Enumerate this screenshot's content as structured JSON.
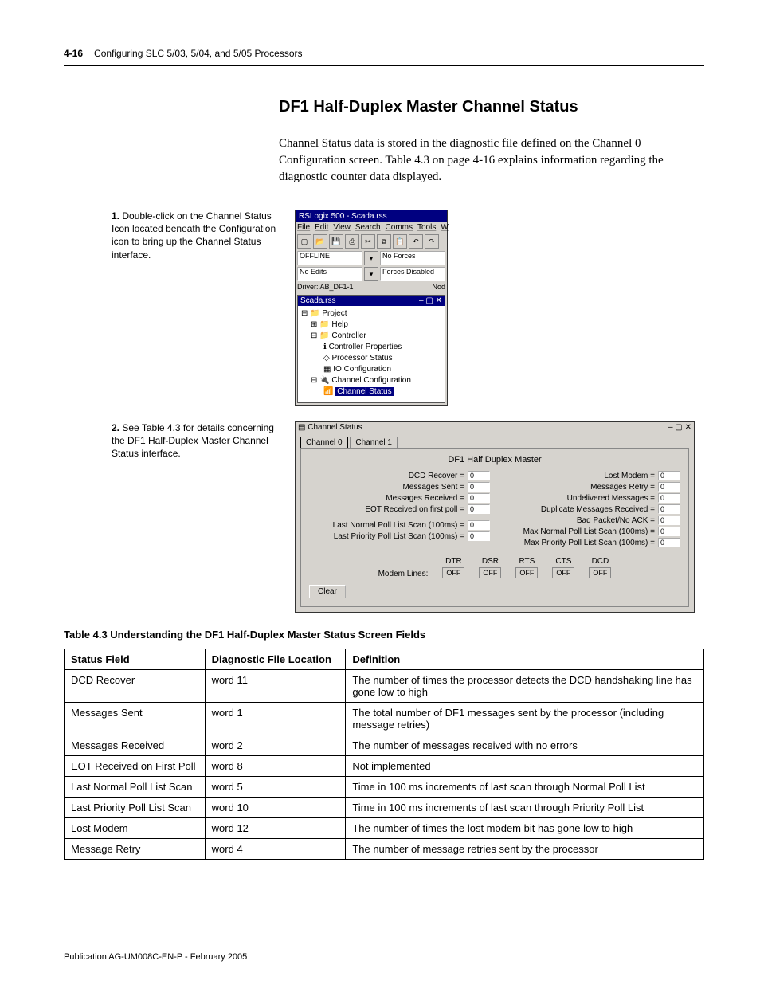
{
  "header": {
    "pagenum": "4-16",
    "chapter": "Configuring SLC 5/03, 5/04, and 5/05 Processors"
  },
  "section_title": "DF1 Half-Duplex Master Channel Status",
  "intro": "Channel Status data is stored in the diagnostic file defined on the Channel 0 Configuration screen. Table 4.3 on page 4-16 explains information regarding the diagnostic counter data displayed.",
  "callout1": {
    "num": "1.",
    "text": "Double-click on the Channel Status Icon located beneath the Configuration icon to bring up the Channel Status interface."
  },
  "callout2": {
    "num": "2.",
    "text": "See Table 4.3 for details concerning the DF1 Half-Duplex Master Channel Status interface."
  },
  "app": {
    "title": "RSLogix 500 - Scada.rss",
    "menus": [
      "File",
      "Edit",
      "View",
      "Search",
      "Comms",
      "Tools",
      "W"
    ],
    "status_offline": "OFFLINE",
    "status_noforces": "No Forces",
    "status_noedits": "No Edits",
    "status_forcesdisabled": "Forces Disabled",
    "driver": "Driver: AB_DF1-1",
    "node": "Nod",
    "subwin_title": "Scada.rss",
    "tree": {
      "project": "Project",
      "help": "Help",
      "controller": "Controller",
      "controller_props": "Controller Properties",
      "processor_status": "Processor Status",
      "io_config": "IO Configuration",
      "channel_config": "Channel Configuration",
      "channel_status": "Channel Status"
    }
  },
  "chstatus": {
    "title": "Channel Status",
    "tabs": [
      "Channel 0",
      "Channel 1"
    ],
    "subtitle": "DF1 Half Duplex Master",
    "left": [
      {
        "label": "DCD Recover =",
        "val": "0"
      },
      {
        "label": "Messages Sent =",
        "val": "0"
      },
      {
        "label": "Messages Received =",
        "val": "0"
      },
      {
        "label": "EOT Received on first poll =",
        "val": "0"
      },
      {
        "label": "Last Normal Poll List Scan (100ms) =",
        "val": "0"
      },
      {
        "label": "Last Priority Poll List Scan (100ms) =",
        "val": "0"
      }
    ],
    "right": [
      {
        "label": "Lost Modem =",
        "val": "0"
      },
      {
        "label": "Messages Retry =",
        "val": "0"
      },
      {
        "label": "Undelivered Messages =",
        "val": "0"
      },
      {
        "label": "Duplicate Messages Received =",
        "val": "0"
      },
      {
        "label": "Bad Packet/No ACK =",
        "val": "0"
      },
      {
        "label": "Max Normal Poll List Scan (100ms) =",
        "val": "0"
      },
      {
        "label": "Max Priority Poll List Scan (100ms) =",
        "val": "0"
      }
    ],
    "modem_label": "Modem Lines:",
    "modem_cols": [
      "DTR",
      "DSR",
      "RTS",
      "CTS",
      "DCD"
    ],
    "off": "OFF",
    "clear": "Clear"
  },
  "table": {
    "caption": "Table 4.3 Understanding the DF1 Half-Duplex Master Status Screen Fields",
    "headers": [
      "Status Field",
      "Diagnostic File Location",
      "Definition"
    ],
    "rows": [
      [
        "DCD Recover",
        "word 11",
        "The number of times the processor detects the DCD handshaking line has gone low to high"
      ],
      [
        "Messages Sent",
        "word 1",
        "The total number of DF1 messages sent by the processor (including message retries)"
      ],
      [
        "Messages Received",
        "word 2",
        "The number of messages received with no errors"
      ],
      [
        "EOT Received on First Poll",
        "word 8",
        "Not implemented"
      ],
      [
        "Last Normal Poll List Scan",
        "word 5",
        "Time in 100 ms increments of last scan through Normal Poll List"
      ],
      [
        "Last Priority Poll List Scan",
        "word 10",
        "Time in 100 ms increments of last scan through Priority Poll List"
      ],
      [
        "Lost Modem",
        "word 12",
        "The number of times the lost modem bit has gone low to high"
      ],
      [
        "Message Retry",
        "word 4",
        "The number of message retries sent by the processor"
      ]
    ]
  },
  "footer": "Publication AG-UM008C-EN-P - February 2005"
}
